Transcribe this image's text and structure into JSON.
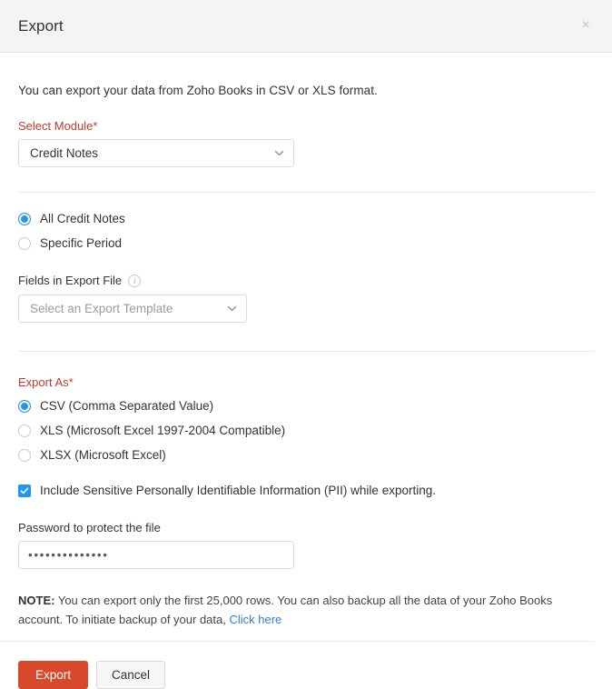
{
  "dialog": {
    "title": "Export",
    "close_icon": "close-icon",
    "intro": "You can export your data from Zoho Books in CSV or XLS format."
  },
  "module": {
    "label": "Select Module*",
    "selected": "Credit Notes",
    "chevron_icon": "chevron-down-icon"
  },
  "scope": {
    "options": [
      {
        "label": "All Credit Notes",
        "selected": true
      },
      {
        "label": "Specific Period",
        "selected": false
      }
    ]
  },
  "fields_in_export": {
    "label": "Fields in Export File",
    "info_icon": "info-icon",
    "placeholder": "Select an Export Template",
    "value": "",
    "chevron_icon": "chevron-down-icon"
  },
  "export_as": {
    "label": "Export As*",
    "options": [
      {
        "label": "CSV (Comma Separated Value)",
        "selected": true
      },
      {
        "label": "XLS (Microsoft Excel 1997-2004 Compatible)",
        "selected": false
      },
      {
        "label": "XLSX (Microsoft Excel)",
        "selected": false
      }
    ]
  },
  "pii": {
    "label": "Include Sensitive Personally Identifiable Information (PII) while exporting.",
    "checked": true,
    "check_icon": "checkmark-icon"
  },
  "password": {
    "label": "Password to protect the file",
    "value": "••••••••••••••",
    "placeholder": ""
  },
  "note": {
    "label": "NOTE:",
    "text": "You can export only the first 25,000 rows. You can also backup all the data of your Zoho Books account. To initiate backup of your data,",
    "link": "Click here"
  },
  "footer": {
    "export_label": "Export",
    "cancel_label": "Cancel"
  },
  "colors": {
    "primary_button": "#d8492c",
    "required_label": "#c0392b",
    "accent_selected": "#2196f3",
    "link": "#2f80d6",
    "header_bg": "#f4f4f4"
  }
}
